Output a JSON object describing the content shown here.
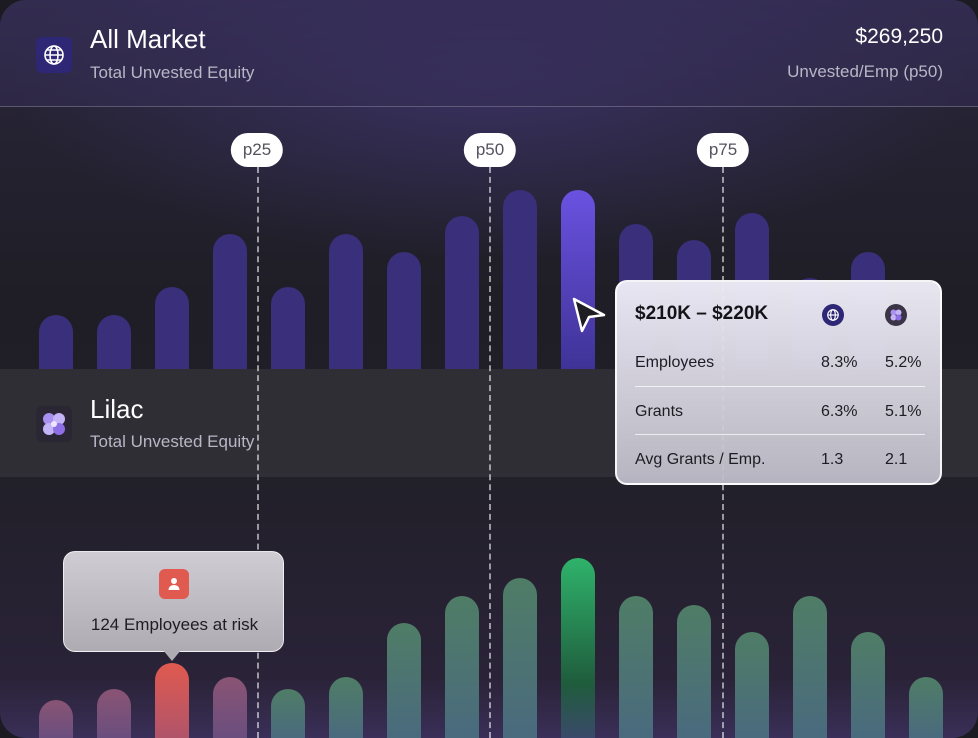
{
  "header": {
    "title": "All Market",
    "subtitle": "Total Unvested Equity",
    "value": "$269,250",
    "value_label": "Unvested/Emp (p50)",
    "icon": "globe-icon"
  },
  "company_band": {
    "title": "Lilac",
    "subtitle": "Total Unvested Equity",
    "icon": "lilac-flower-icon"
  },
  "percentile_markers": [
    "p25",
    "p50",
    "p75"
  ],
  "tooltip": {
    "range": "$210K – $220K",
    "column_icons": [
      "globe-icon",
      "lilac-flower-icon"
    ],
    "rows": [
      {
        "label": "Employees",
        "market": "8.3%",
        "company": "5.2%"
      },
      {
        "label": "Grants",
        "market": "6.3%",
        "company": "5.1%"
      },
      {
        "label": "Avg Grants / Emp.",
        "market": "1.3",
        "company": "2.1"
      }
    ]
  },
  "risk_callout": {
    "text": "124 Employees at risk",
    "icon": "person-icon",
    "color": "#e05a4f"
  },
  "colors": {
    "market_bar": "#3a2f7a",
    "market_highlight": "#6a52e0",
    "company_bar": "#4f7d66",
    "company_highlight": "#2fb36b",
    "risk_bar": "#e05a4f"
  },
  "chart_data": [
    {
      "type": "bar",
      "series": [
        {
          "name": "All Market",
          "values": [
            54,
            54,
            82,
            135,
            82,
            135,
            117,
            153,
            179,
            179,
            145,
            129,
            156,
            91,
            117
          ]
        }
      ],
      "highlight_index": 9
    },
    {
      "type": "bar",
      "series": [
        {
          "name": "Lilac",
          "values": [
            38,
            49,
            75,
            61,
            49,
            61,
            115,
            142,
            160,
            180,
            142,
            133,
            106,
            142,
            106,
            61
          ]
        }
      ],
      "highlight_index": 9,
      "risk_indices": [
        0,
        1,
        2,
        3
      ],
      "risk_selected_index": 2
    }
  ]
}
